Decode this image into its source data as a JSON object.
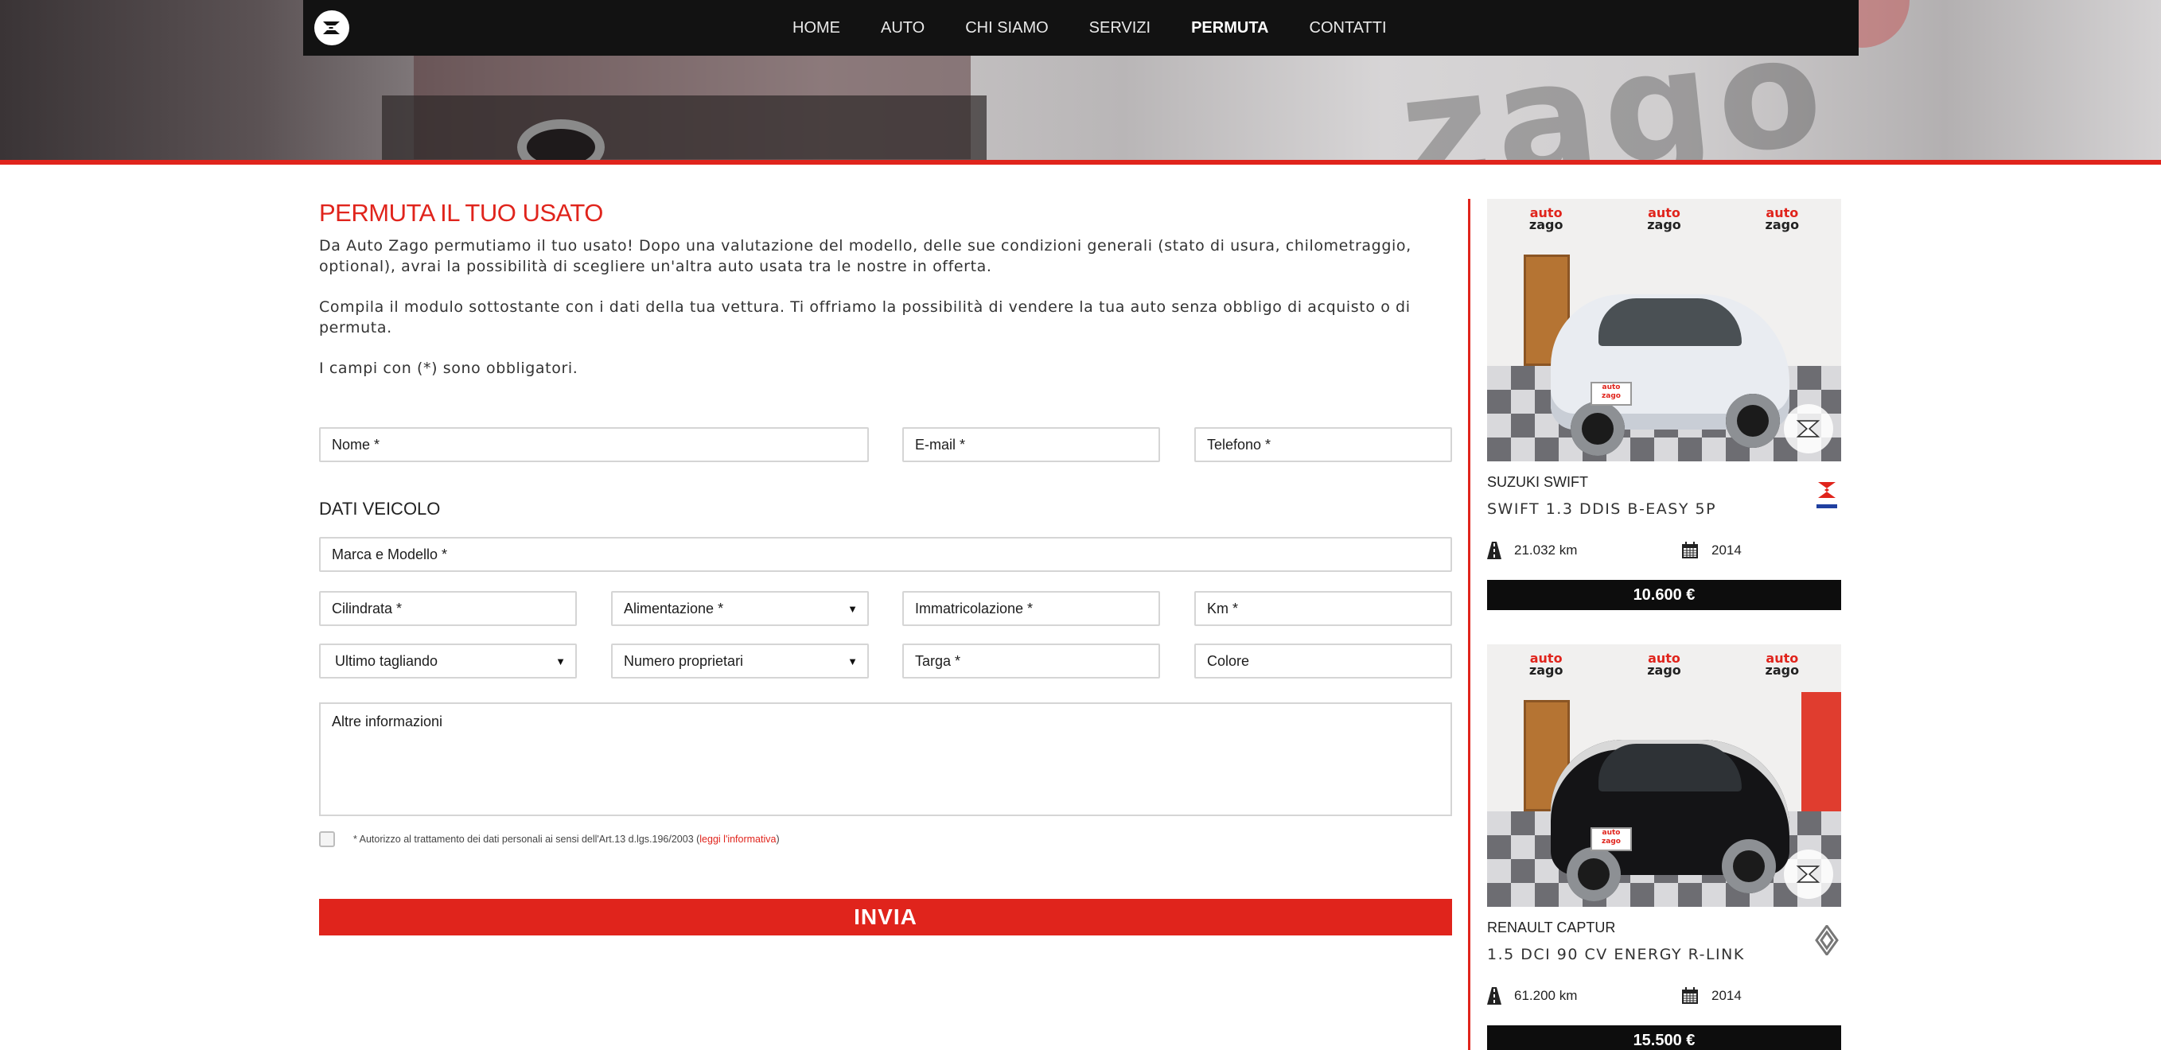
{
  "nav": {
    "logo_alt": "Auto Zago logo",
    "items": [
      {
        "label": "HOME"
      },
      {
        "label": "AUTO"
      },
      {
        "label": "CHI SIAMO"
      },
      {
        "label": "SERVIZI"
      },
      {
        "label": "PERMUTA",
        "active": true
      },
      {
        "label": "CONTATTI"
      }
    ]
  },
  "main": {
    "title": "PERMUTA IL TUO USATO",
    "paragraphs": [
      "Da Auto Zago permutiamo il tuo usato! Dopo una valutazione del modello, delle sue condizioni generali (stato di usura, chilometraggio, optional), avrai la possibilità di scegliere un'altra auto usata tra le nostre in offerta.",
      "Compila il modulo sottostante con i dati della tua vettura. Ti offriamo la possibilità di vendere la tua auto senza obbligo di acquisto o di permuta.",
      "I campi con (*) sono obbligatori."
    ]
  },
  "form": {
    "nome": "Nome *",
    "email": "E-mail *",
    "telefono": "Telefono *",
    "section_title": "DATI VEICOLO",
    "marca_modello": "Marca e Modello *",
    "cilindrata": "Cilindrata *",
    "alimentazione": "Alimentazione *",
    "immatricolazione": "Immatricolazione *",
    "km": "Km *",
    "ultimo_tagliando": "Ultimo tagliando",
    "numero_proprietari": "Numero proprietari",
    "targa": "Targa *",
    "colore": "Colore",
    "altre_informazioni": "Altre informazioni",
    "consent_text": "* Autorizzo al trattamento dei dati personali ai sensi dell'Art.13 d.lgs.196/2003 (",
    "consent_link": "leggi l'informativa",
    "consent_close": ")",
    "submit": "INVIA"
  },
  "cars": [
    {
      "make": "SUZUKI SWIFT",
      "model": "SWIFT 1.3 DDIS B-EASY 5P",
      "km": "21.032 km",
      "year": "2014",
      "price": "10.600 €",
      "car_color": "#e9ecf1",
      "brand_icon": "suzuki-logo-icon"
    },
    {
      "make": "RENAULT CAPTUR",
      "model": "1.5 DCI 90 CV ENERGY R-LINK",
      "km": "61.200 km",
      "year": "2014",
      "price": "15.500 €",
      "car_color": "#141416",
      "brand_icon": "renault-logo-icon"
    }
  ],
  "photo_branding": {
    "auto": "auto",
    "zago": "zago"
  },
  "colors": {
    "accent": "#e0241c",
    "nav_bg": "#121212",
    "price_bg": "#0d0d0d"
  }
}
